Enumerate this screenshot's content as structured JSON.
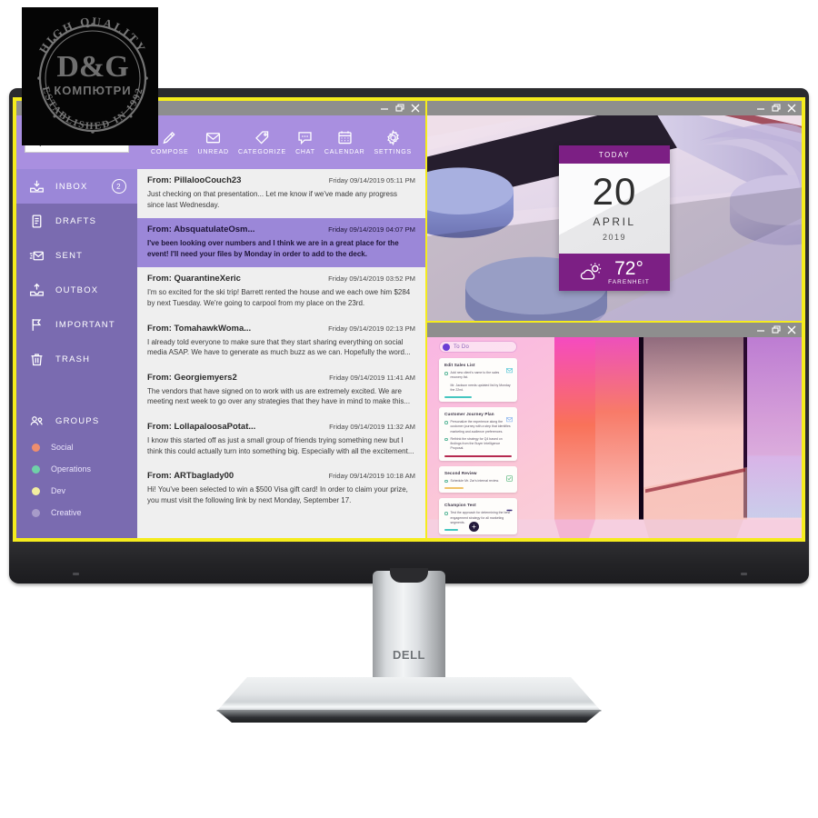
{
  "watermark": {
    "top_text": "HIGH QUALITY",
    "brand": "D&G",
    "sub_text": "КОМПЮТРИ",
    "bottom_text": "ESTABLISHED IN 1992"
  },
  "monitor": {
    "brand": "DELL",
    "screen_border_color": "#f5ec1d"
  },
  "mail_window": {
    "window_controls": [
      "minimize",
      "restore",
      "close"
    ],
    "search": {
      "value": "",
      "placeholder": "",
      "icon": "search-icon"
    },
    "toolbar": [
      {
        "label": "COMPOSE",
        "icon": "pencil-icon"
      },
      {
        "label": "UNREAD",
        "icon": "envelope-icon"
      },
      {
        "label": "CATEGORIZE",
        "icon": "tag-icon"
      },
      {
        "label": "CHAT",
        "icon": "chat-bubble-icon"
      },
      {
        "label": "CALENDAR",
        "icon": "calendar-icon"
      },
      {
        "label": "SETTINGS",
        "icon": "gear-icon"
      }
    ],
    "nav": [
      {
        "label": "INBOX",
        "icon": "inbox-icon",
        "badge": "2",
        "active": true
      },
      {
        "label": "DRAFTS",
        "icon": "document-icon",
        "badge": "",
        "active": false
      },
      {
        "label": "SENT",
        "icon": "sent-envelope-icon",
        "badge": "",
        "active": false
      },
      {
        "label": "OUTBOX",
        "icon": "outbox-icon",
        "badge": "",
        "active": false
      },
      {
        "label": "IMPORTANT",
        "icon": "flag-icon",
        "badge": "",
        "active": false
      },
      {
        "label": "TRASH",
        "icon": "trash-icon",
        "badge": "",
        "active": false
      }
    ],
    "groups_header": {
      "label": "GROUPS",
      "icon": "people-icon"
    },
    "groups": [
      {
        "label": "Social",
        "color": "#ef8e6e"
      },
      {
        "label": "Operations",
        "color": "#6fd1a8"
      },
      {
        "label": "Dev",
        "color": "#f2eea0"
      },
      {
        "label": "Creative",
        "color": "#a79bc9"
      }
    ],
    "emails": [
      {
        "from": "From: PillalooCouch23",
        "date": "Friday 09/14/2019 05:11 PM",
        "preview": "Just checking on that presentation... Let me know if we've made any progress since last Wednesday.",
        "selected": false
      },
      {
        "from": "From: AbsquatulateOsm...",
        "date": "Friday 09/14/2019 04:07 PM",
        "preview": "I've been looking over numbers and I think we are in a great place for the event! I'll need your files by Monday in order to add to the deck.",
        "selected": true
      },
      {
        "from": "From: QuarantineXeric",
        "date": "Friday 09/14/2019 03:52 PM",
        "preview": "I'm so excited for the ski trip! Barrett rented the house and we each owe him $284 by next Tuesday. We're going to carpool from my place on the 23rd.",
        "selected": false
      },
      {
        "from": "From: TomahawkWoma...",
        "date": "Friday 09/14/2019 02:13 PM",
        "preview": "I already told everyone to make sure that they start sharing everything on social media ASAP. We have to generate as much buzz as we can. Hopefully the word...",
        "selected": false
      },
      {
        "from": "From: Georgiemyers2",
        "date": "Friday 09/14/2019 11:41 AM",
        "preview": "The vendors that have signed on to work with us are extremely excited. We are meeting next week to go over any strategies that they have in mind to make this...",
        "selected": false
      },
      {
        "from": "From: LollapaloosaPotat...",
        "date": "Friday 09/14/2019 11:32 AM",
        "preview": "I know this started off as just a small group of friends trying something new but I think this could actually turn into something big. Especially with all the excitement...",
        "selected": false
      },
      {
        "from": "From: ARTbaglady00",
        "date": "Friday 09/14/2019 10:18 AM",
        "preview": "Hi! You've been selected to win a $500 Visa gift card! In order to claim your prize, you must visit the following link by next Monday, September 17.",
        "selected": false
      }
    ]
  },
  "calendar_widget": {
    "header": "TODAY",
    "day": "20",
    "month": "APRIL",
    "year": "2019",
    "temperature": "72°",
    "unit": "FARENHEIT",
    "weather_icon": "partly-cloudy-icon",
    "accent_color": "#7c1f84"
  },
  "todo_window": {
    "pill_label": "To Do",
    "add_button": "+",
    "cards": [
      {
        "title": "Edit Sales List",
        "badge_icon": "envelope-icon",
        "badge_color": "#5ec8d8",
        "bar_color": "#45c6c0",
        "bar_width": "40%",
        "tasks": [
          "Add new client's name to the sales recovery list.",
          "Mr. Jackson needs updated list by Monday the 22nd."
        ]
      },
      {
        "title": "Customer Journey Plan",
        "badge_icon": "envelope-icon",
        "badge_color": "#8fb8ef",
        "bar_color": "#b52a50",
        "bar_width": "100%",
        "tasks": [
          "Personalize the experience along the customer journey with a step that identifies marketing and audience preferences.",
          "Rethink the strategy for Q4 based on findings from the Buyer Intelligence Proposal."
        ]
      },
      {
        "title": "Second Review",
        "badge_icon": "checkbox-icon",
        "badge_color": "#55b47a",
        "bar_color": "#f0c268",
        "bar_width": "28%",
        "tasks": [
          "Schedule Mr. Zar's internal review."
        ]
      },
      {
        "title": "Champion Test",
        "badge_icon": "bar-icon",
        "badge_color": "#3a2d7a",
        "bar_color": "#45c6c0",
        "bar_width": "20%",
        "tasks": [
          "Test the approach for determining the best engagement strategy for all marketing segments."
        ]
      }
    ]
  }
}
